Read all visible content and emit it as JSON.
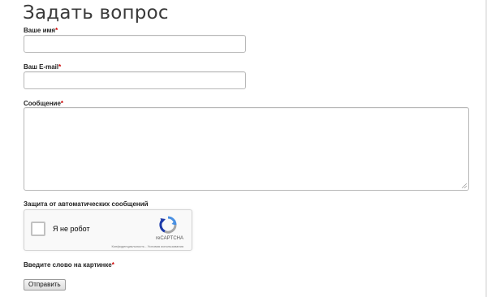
{
  "page": {
    "title": "Задать вопрос"
  },
  "form": {
    "name": {
      "label": "Ваше имя",
      "required_mark": "*",
      "value": "",
      "placeholder": ""
    },
    "email": {
      "label": "Ваш E-mail",
      "required_mark": "*",
      "value": "",
      "placeholder": ""
    },
    "message": {
      "label": "Сообщение",
      "required_mark": "*",
      "value": "",
      "placeholder": ""
    },
    "spam_protection": {
      "label": "Защита от автоматических сообщений"
    },
    "recaptcha": {
      "checkbox_label": "Я не робот",
      "brand": "reCAPTCHA",
      "terms": "Конфиденциальность - Условия использования",
      "checked": false
    },
    "captcha_word": {
      "label": "Введите слово на картинке",
      "required_mark": "*"
    },
    "submit_label": "Отправить"
  },
  "colors": {
    "required": "#cc0000",
    "recaptcha_blue": "#4a90e2",
    "recaptcha_gray": "#a6a6a6",
    "recaptcha_darkblue": "#1c3aa9"
  },
  "icons": {
    "recaptcha_logo": "recaptcha-logo-icon",
    "resize_grip": "resize-grip-icon"
  }
}
